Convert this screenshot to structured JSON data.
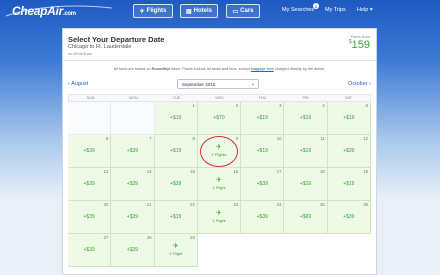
{
  "brand": {
    "name": "CheapAir",
    "suffix": ".com"
  },
  "nav": {
    "flights": "Flights",
    "hotels": "Hotels",
    "cars": "Cars",
    "my_searches": "My Searches",
    "my_searches_badge": "1",
    "my_trips": "My Trips",
    "help": "Help"
  },
  "header": {
    "title": "Select Your Departure Date",
    "route": "Chicago to Ft. Lauderdale",
    "airlines": "on All Airlines",
    "fares_from_label": "Fares from",
    "fares_from_currency": "$",
    "fares_from_value": "159"
  },
  "notice": {
    "text_before": "All fares are based on ",
    "bold": "Roundtrip",
    "text_mid": " travel. Prices include all taxes and fees, except ",
    "link": "baggage fees",
    "text_after": " charged directly by the airline."
  },
  "month_nav": {
    "prev": "August",
    "current": "September 2015",
    "next": "October"
  },
  "weekdays": [
    "SUN",
    "MON",
    "TUE",
    "WED",
    "THU",
    "FRI",
    "SAT"
  ],
  "calendar": {
    "leading_empty": 2,
    "days": [
      {
        "day": "1",
        "price": "+$19"
      },
      {
        "day": "2",
        "price": "+$70"
      },
      {
        "day": "3",
        "price": "+$19"
      },
      {
        "day": "4",
        "price": "+$19"
      },
      {
        "day": "5",
        "price": "+$19"
      },
      {
        "day": "6",
        "price": "+$39"
      },
      {
        "day": "7",
        "price": "+$39"
      },
      {
        "day": "8",
        "price": "+$19"
      },
      {
        "day": "9",
        "flights": "2 Flights",
        "highlighted": true
      },
      {
        "day": "10",
        "price": "+$19"
      },
      {
        "day": "11",
        "price": "+$19"
      },
      {
        "day": "12",
        "price": "+$39"
      },
      {
        "day": "13",
        "price": "+$39"
      },
      {
        "day": "14",
        "price": "+$39"
      },
      {
        "day": "15",
        "price": "+$39"
      },
      {
        "day": "16",
        "flights": "1 Flight"
      },
      {
        "day": "17",
        "price": "+$39"
      },
      {
        "day": "18",
        "price": "+$19"
      },
      {
        "day": "19",
        "price": "+$19"
      },
      {
        "day": "20",
        "price": "+$39"
      },
      {
        "day": "21",
        "price": "+$39"
      },
      {
        "day": "22",
        "price": "+$19"
      },
      {
        "day": "23",
        "flights": "1 Flight"
      },
      {
        "day": "24",
        "price": "+$39"
      },
      {
        "day": "25",
        "price": "+$69"
      },
      {
        "day": "26",
        "price": "+$39"
      },
      {
        "day": "27",
        "price": "+$39"
      },
      {
        "day": "28",
        "price": "+$39"
      },
      {
        "day": "29",
        "flights": "1 Flight"
      }
    ]
  },
  "colors": {
    "brand_blue": "#1e5ac1",
    "price_green": "#37a336",
    "highlight_red": "#d0342c"
  }
}
